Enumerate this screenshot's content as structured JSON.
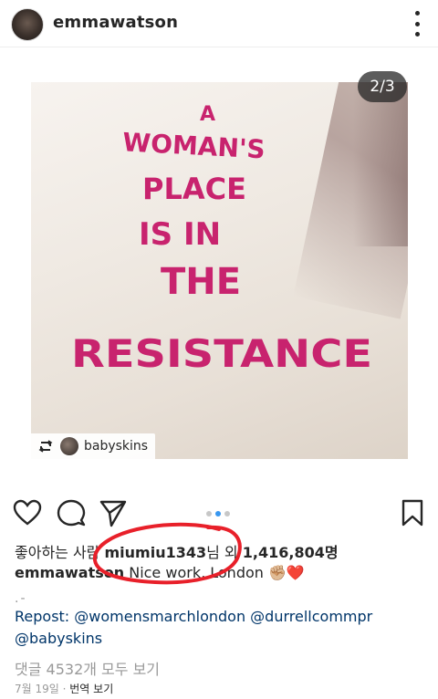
{
  "header": {
    "username": "emmawatson",
    "more_icon": "more-vertical-icon"
  },
  "post": {
    "image_counter": "2/3",
    "embroidery_lines": [
      "A",
      "WOMAN'S",
      "PLACE",
      "IS IN",
      "THE",
      "RESISTANCE"
    ],
    "repost_badge_name": "babyskins",
    "repost_icon": "repost-icon"
  },
  "actions": {
    "like_icon": "heart-icon",
    "comment_icon": "comment-icon",
    "share_icon": "send-icon",
    "save_icon": "bookmark-icon",
    "carousel_dots": 3,
    "active_dot": 2
  },
  "likes": {
    "prefix": "좋아하는 사람",
    "user": "miumiu1343",
    "middle": "님 외",
    "count": "1,416,804명"
  },
  "caption": {
    "user": "emmawatson",
    "text": "Nice work, London ✊🏼❤️"
  },
  "dashes": ".-",
  "repost": {
    "label": "Repost:",
    "mention1": "@womensmarchlondon",
    "mention2": "@durrellcommpr",
    "mention3": "@babyskins"
  },
  "comments_link": "댓글 4532개 모두 보기",
  "date": {
    "text": "7월 19일 ·",
    "translate": "번역 보기"
  },
  "colors": {
    "accent_blue": "#3897f0",
    "link_blue": "#003569",
    "embroidery_pink": "#c8236e",
    "annotation_red": "#e8202a"
  }
}
